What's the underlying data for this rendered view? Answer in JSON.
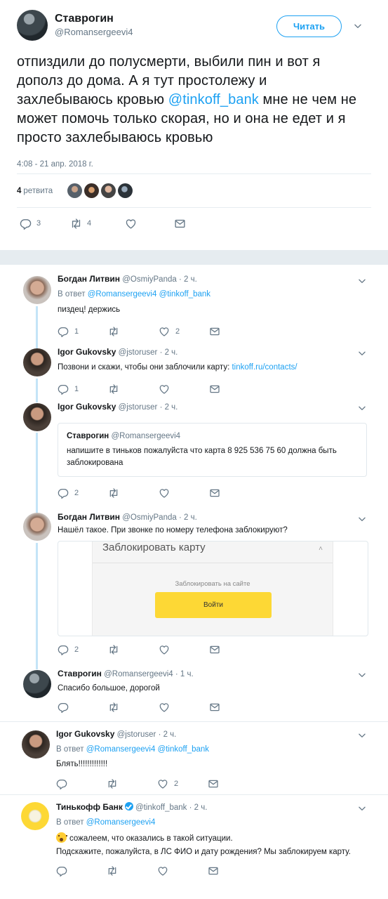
{
  "main_tweet": {
    "author_name": "Ставрогин",
    "author_handle": "@Romansergeevi4",
    "follow_label": "Читать",
    "text_before_mention": "отпиздили до полусмерти, выбили пин и вот я дополз до дома. А я тут простолежу и захлебываюсь кровью ",
    "mention": "@tinkoff_bank",
    "text_after_mention": " мне не чем не может помочь только скорая, но и она не едет и я просто захлебываюсь кровью",
    "date": "4:08 - 21 апр. 2018 г.",
    "retweets_count": "4",
    "retweets_label": "ретвита",
    "reply_count": "3",
    "retweet_count": "4"
  },
  "replies": [
    {
      "name": "Богдан Литвин",
      "handle": "@OsmiyPanda",
      "time": "· 2 ч.",
      "reply_prefix": "В ответ",
      "reply_to_1": "@Romansergeevi4",
      "reply_to_2": "@tinkoff_bank",
      "text": "пиздец! держись",
      "reply_count": "1",
      "like_count": "2"
    },
    {
      "name": "Igor Gukovsky",
      "handle": "@jstoruser",
      "time": "· 2 ч.",
      "text": "Позвони и скажи, чтобы они заблочили карту: ",
      "link": "tinkoff.ru/contacts/",
      "reply_count": "1"
    },
    {
      "name": "Igor Gukovsky",
      "handle": "@jstoruser",
      "time": "· 2 ч.",
      "quote_name": "Ставрогин",
      "quote_handle": "@Romansergeevi4",
      "quote_text": "напишите в тиньков пожалуйста что карта 8 925 536 75 60 должна быть заблокирована",
      "reply_count": "2"
    },
    {
      "name": "Богдан Литвин",
      "handle": "@OsmiyPanda",
      "time": "· 2 ч.",
      "text": "Нашёл такое. При звонке по номеру телефона заблокируют?",
      "card_title": "Заблокировать карту",
      "card_caret": "˄",
      "card_sub": "Заблокировать на сайте",
      "card_button": "Войти",
      "reply_count": "2"
    },
    {
      "name": "Ставрогин",
      "handle": "@Romansergeevi4",
      "time": "· 1 ч.",
      "text": "Спасибо большое, дорогой"
    },
    {
      "name": "Igor Gukovsky",
      "handle": "@jstoruser",
      "time": "· 2 ч.",
      "reply_prefix": "В ответ",
      "reply_to_1": "@Romansergeevi4",
      "reply_to_2": "@tinkoff_bank",
      "text": "Блять!!!!!!!!!!!!!",
      "like_count": "2"
    },
    {
      "name": "Тинькофф Банк",
      "handle": "@tinkoff_bank",
      "time": "· 2 ч.",
      "reply_prefix": "В ответ",
      "reply_to_1": "@Romansergeevi4",
      "text_line1": "сожалеем, что оказались в такой ситуации.",
      "text_line2": "Подскажите, пожалуйста, в ЛС ФИО и дату рождения? Мы заблокируем карту."
    }
  ],
  "icons": {
    "reply": "reply-icon",
    "retweet": "retweet-icon",
    "like": "heart-icon",
    "dm": "envelope-icon",
    "caret": "chevron-down-icon"
  },
  "colors": {
    "accent": "#1da1f2",
    "thread_line": "#c4e4f7",
    "card_button": "#fdd835"
  }
}
